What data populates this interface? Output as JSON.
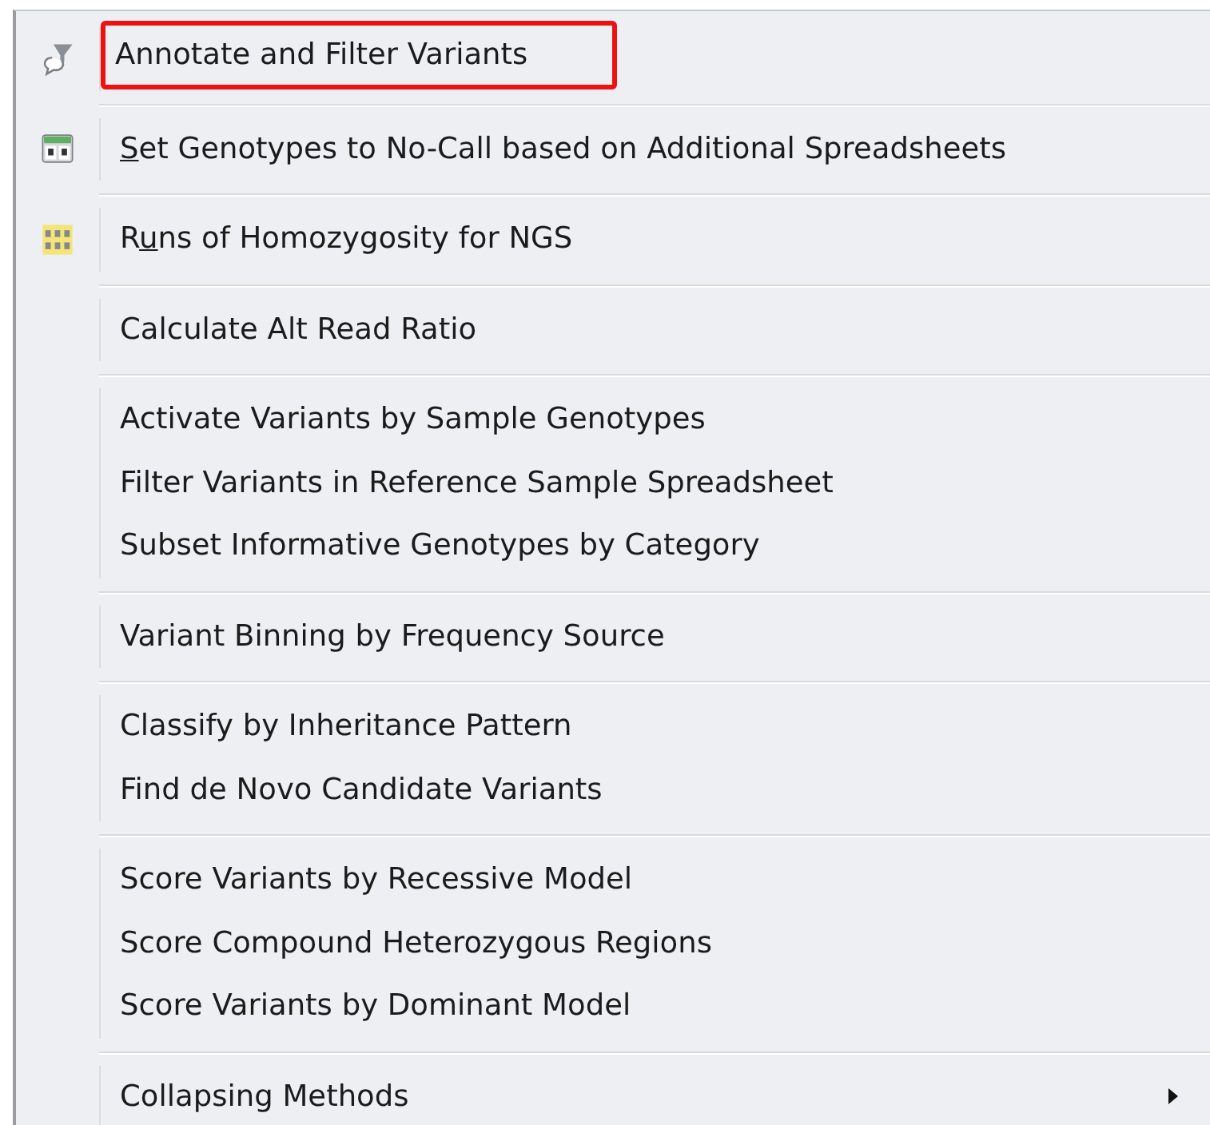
{
  "menu": {
    "groups": [
      {
        "items": [
          {
            "kind": "filter",
            "label": [
              {
                "text": "Annotate and Filter Variants",
                "underlined": false
              }
            ],
            "highlighted": true
          }
        ]
      },
      {
        "items": [
          {
            "kind": "grid",
            "label": [
              {
                "text": "S",
                "underlined": true
              },
              {
                "text": "et Genotypes to No-Call based on Additional Spreadsheets",
                "underlined": false
              }
            ],
            "highlighted": false
          }
        ]
      },
      {
        "items": [
          {
            "kind": "letters",
            "label": [
              {
                "text": "R",
                "underlined": false
              },
              {
                "text": "u",
                "underlined": true
              },
              {
                "text": "ns of Homozygosity for NGS",
                "underlined": false
              }
            ],
            "highlighted": false
          }
        ]
      },
      {
        "items": [
          {
            "label": [
              {
                "text": "Calculate Alt Read Ratio",
                "underlined": false
              }
            ],
            "highlighted": false
          }
        ]
      },
      {
        "items": [
          {
            "label": [
              {
                "text": "Activate Variants by Sample Genotypes",
                "underlined": false
              }
            ],
            "highlighted": false
          },
          {
            "label": [
              {
                "text": "Filter Variants in Reference Sample Spreadsheet",
                "underlined": false
              }
            ],
            "highlighted": false
          },
          {
            "label": [
              {
                "text": "Subset Informative Genotypes by Category",
                "underlined": false
              }
            ],
            "highlighted": false
          }
        ]
      },
      {
        "items": [
          {
            "label": [
              {
                "text": "Variant Binning by Frequency Source",
                "underlined": false
              }
            ],
            "highlighted": false
          }
        ]
      },
      {
        "items": [
          {
            "label": [
              {
                "text": "Classify by Inheritance Pattern",
                "underlined": false
              }
            ],
            "highlighted": false
          },
          {
            "label": [
              {
                "text": "Find de Novo Candidate Variants",
                "underlined": false
              }
            ],
            "highlighted": false
          }
        ]
      },
      {
        "items": [
          {
            "label": [
              {
                "text": "Score Variants by Recessive Model",
                "underlined": false
              }
            ],
            "highlighted": false
          },
          {
            "label": [
              {
                "text": "Score Compound Heterozygous Regions",
                "underlined": false
              }
            ],
            "highlighted": false
          },
          {
            "label": [
              {
                "text": "Score Variants by Dominant Model",
                "underlined": false
              }
            ],
            "highlighted": false
          }
        ]
      },
      {
        "items": [
          {
            "label": [
              {
                "text": "Collapsing Methods",
                "underlined": false
              }
            ],
            "submenu": true,
            "highlighted": false
          }
        ]
      }
    ]
  }
}
